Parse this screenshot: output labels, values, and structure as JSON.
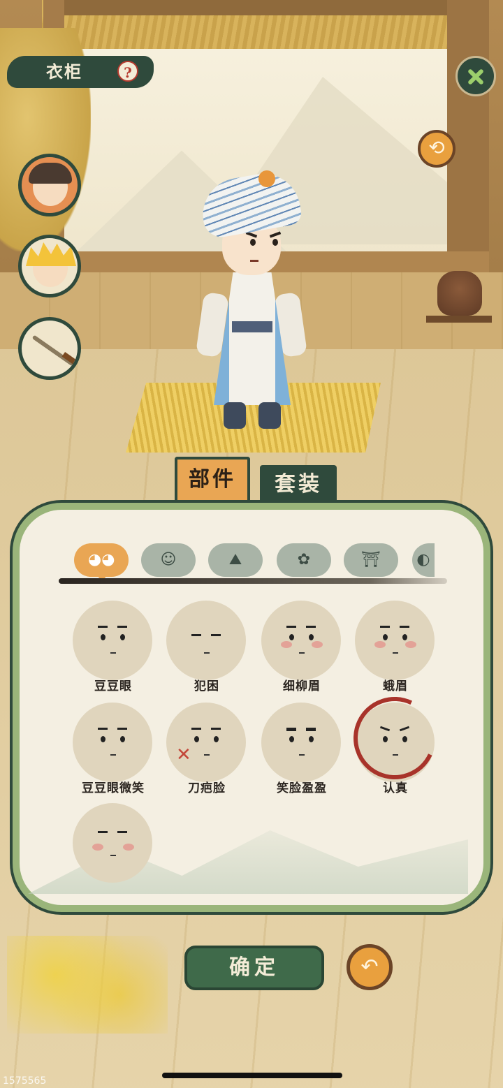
{
  "header": {
    "title": "衣柜",
    "help_glyph": "?"
  },
  "buttons": {
    "close_icon": "close-icon",
    "refresh_glyph": "⟲"
  },
  "avatars": [
    {
      "name": "hero-brown-hair",
      "icon": "avatar-icon"
    },
    {
      "name": "hero-golden-hair",
      "icon": "avatar-icon"
    },
    {
      "name": "sword",
      "icon": "sword-icon"
    }
  ],
  "tabs": {
    "parts": "部件",
    "outfit": "套装",
    "active": "parts"
  },
  "categories": [
    {
      "name": "face",
      "glyph": "◕◕",
      "active": true
    },
    {
      "name": "hair",
      "glyph": "☺",
      "active": false
    },
    {
      "name": "clothes",
      "glyph": "⛰",
      "active": false
    },
    {
      "name": "accessory",
      "glyph": "✿",
      "active": false
    },
    {
      "name": "pants",
      "glyph": "⛩",
      "active": false
    },
    {
      "name": "more",
      "glyph": "◐",
      "active": false
    }
  ],
  "faces": [
    {
      "label": "豆豆眼"
    },
    {
      "label": "犯困"
    },
    {
      "label": "细柳眉"
    },
    {
      "label": "蛾眉"
    },
    {
      "label": "豆豆眼微笑"
    },
    {
      "label": "刀疤脸"
    },
    {
      "label": "笑脸盈盈"
    },
    {
      "label": "认真",
      "selected": true
    },
    {
      "label": ""
    }
  ],
  "footer": {
    "confirm": "确定",
    "back_glyph": "↶"
  },
  "watermark": "1575565",
  "colors": {
    "accent": "#e9a654",
    "dark_green": "#2f4a3c",
    "panel_border": "#9ab57a"
  }
}
